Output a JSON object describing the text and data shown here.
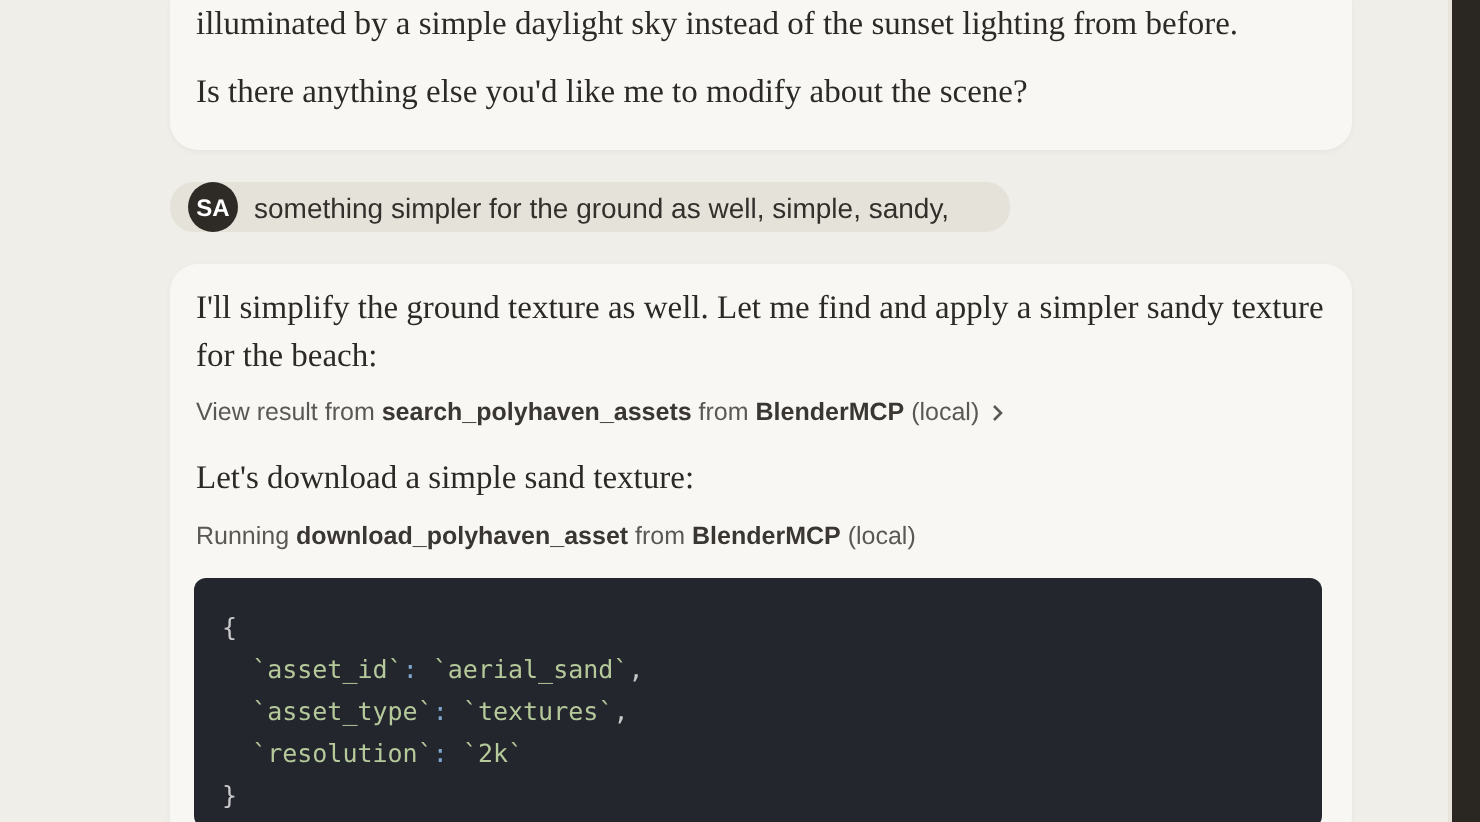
{
  "messages": [
    {
      "kind": "assistant",
      "blocks": [
        {
          "kind": "paragraph",
          "text": "illuminated by a simple daylight sky instead of the sunset lighting from before."
        },
        {
          "kind": "paragraph",
          "text": "Is there anything else you'd like me to modify about the scene?"
        }
      ]
    },
    {
      "kind": "user",
      "initials": "SA",
      "text": "something simpler for the ground as well, simple, sandy,"
    },
    {
      "kind": "assistant",
      "blocks": [
        {
          "kind": "paragraph",
          "text": "I'll simplify the ground texture as well. Let me find and apply a simpler sandy texture for the beach:"
        },
        {
          "kind": "tool_result",
          "text": "View result from **search_polyhaven_assets** from **BlenderMCP** (local)"
        },
        {
          "kind": "paragraph",
          "text": "Let's download a simple sand texture:"
        },
        {
          "kind": "tool_running",
          "text": "Running **download_polyhaven_asset** from **BlenderMCP** (local)"
        },
        {
          "kind": "code",
          "lines": [
            [
              {
                "kind": "punct",
                "text": "{"
              }
            ],
            [
              {
                "kind": "key",
                "text": "  `asset_id`"
              },
              {
                "kind": "colon",
                "text": ": "
              },
              {
                "kind": "string",
                "text": "`aerial_sand`"
              },
              {
                "kind": "punct",
                "text": ","
              }
            ],
            [
              {
                "kind": "key",
                "text": "  `asset_type`"
              },
              {
                "kind": "colon",
                "text": ": "
              },
              {
                "kind": "string",
                "text": "`textures`"
              },
              {
                "kind": "punct",
                "text": ","
              }
            ],
            [
              {
                "kind": "key",
                "text": "  `resolution`"
              },
              {
                "kind": "colon",
                "text": ": "
              },
              {
                "kind": "string",
                "text": "`2k`"
              }
            ],
            [
              {
                "kind": "punct",
                "text": "}"
              }
            ]
          ]
        }
      ]
    }
  ]
}
